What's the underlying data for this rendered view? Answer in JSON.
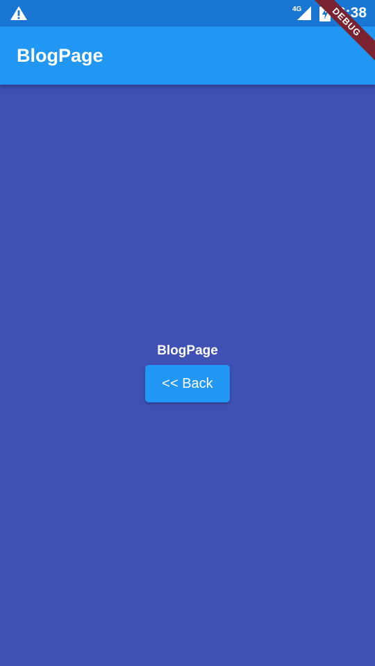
{
  "status_bar": {
    "network": "4G",
    "time": "6:38",
    "icons": [
      "warning-icon",
      "signal-icon",
      "battery-charging-icon"
    ]
  },
  "app_bar": {
    "title": "BlogPage"
  },
  "main": {
    "label": "BlogPage",
    "back_button_label": "<< Back"
  },
  "debug_banner": {
    "text": "DEBUG"
  },
  "colors": {
    "status_bar": "#1976d2",
    "app_bar": "#2196f3",
    "background": "#3f51b5",
    "button": "#2196f3",
    "banner": "#7b2230"
  }
}
